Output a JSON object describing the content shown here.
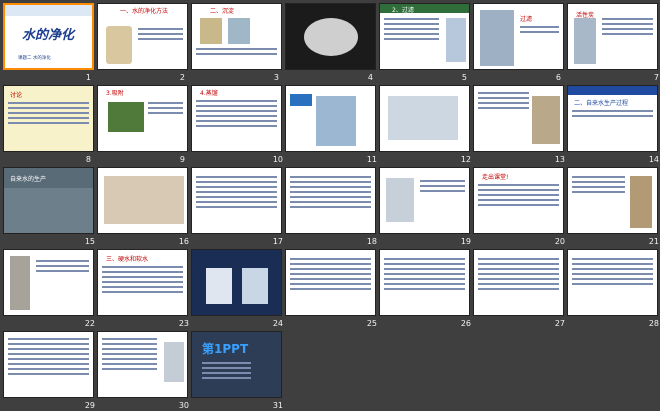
{
  "slides": [
    {
      "num": "1",
      "title": "水的净化",
      "sub": "课题二 水的净化"
    },
    {
      "num": "2",
      "title": "一、水的净化方法"
    },
    {
      "num": "3",
      "title": "二、沉淀"
    },
    {
      "num": "4"
    },
    {
      "num": "5",
      "title": "2、过滤"
    },
    {
      "num": "6",
      "title": "过滤"
    },
    {
      "num": "7",
      "title": "活性炭"
    },
    {
      "num": "8",
      "title": "讨论"
    },
    {
      "num": "9",
      "title": "3.吸附"
    },
    {
      "num": "10",
      "title": "4.蒸馏"
    },
    {
      "num": "11"
    },
    {
      "num": "12"
    },
    {
      "num": "13"
    },
    {
      "num": "14",
      "title": "二、自来水生产过程"
    },
    {
      "num": "15",
      "title": "自来水的生产"
    },
    {
      "num": "16"
    },
    {
      "num": "17"
    },
    {
      "num": "18"
    },
    {
      "num": "19"
    },
    {
      "num": "20",
      "title": "走出课堂!"
    },
    {
      "num": "21"
    },
    {
      "num": "22"
    },
    {
      "num": "23",
      "title": "三、硬水和软水"
    },
    {
      "num": "24"
    },
    {
      "num": "25"
    },
    {
      "num": "26"
    },
    {
      "num": "27"
    },
    {
      "num": "28"
    },
    {
      "num": "29"
    },
    {
      "num": "30"
    },
    {
      "num": "31",
      "title": "第1PPT"
    }
  ]
}
